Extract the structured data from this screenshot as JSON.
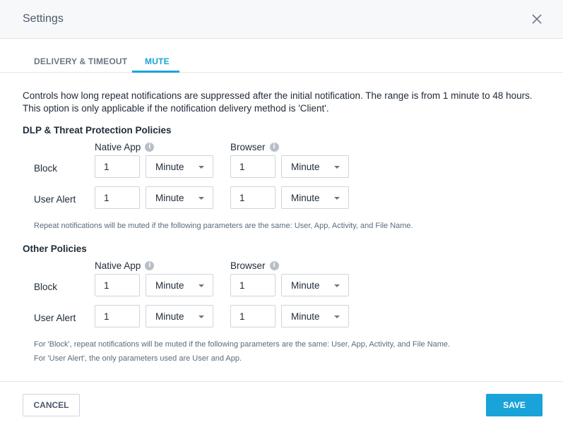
{
  "header": {
    "title": "Settings"
  },
  "tabs": [
    {
      "label": "DELIVERY & TIMEOUT",
      "active": false
    },
    {
      "label": "MUTE",
      "active": true
    }
  ],
  "description": "Controls how long repeat notifications are suppressed after the initial notification. The range is from 1 minute to 48 hours. This option is only applicable if the notification delivery method is 'Client'.",
  "columns": {
    "native_app": "Native App",
    "browser": "Browser",
    "info_glyph": "i"
  },
  "sections": [
    {
      "title": "DLP & Threat Protection Policies",
      "rows": [
        {
          "label": "Block",
          "native_value": "1",
          "native_unit": "Minute",
          "browser_value": "1",
          "browser_unit": "Minute"
        },
        {
          "label": "User Alert",
          "native_value": "1",
          "native_unit": "Minute",
          "browser_value": "1",
          "browser_unit": "Minute"
        }
      ],
      "notes": [
        "Repeat notifications will be muted if the following parameters are the same: User, App, Activity, and File Name."
      ]
    },
    {
      "title": "Other Policies",
      "rows": [
        {
          "label": "Block",
          "native_value": "1",
          "native_unit": "Minute",
          "browser_value": "1",
          "browser_unit": "Minute"
        },
        {
          "label": "User Alert",
          "native_value": "1",
          "native_unit": "Minute",
          "browser_value": "1",
          "browser_unit": "Minute"
        }
      ],
      "notes": [
        "For 'Block', repeat notifications will be muted if the following parameters are the same: User, App, Activity, and File Name.",
        "For 'User Alert', the only parameters used are User and App."
      ]
    }
  ],
  "footer": {
    "cancel_label": "CANCEL",
    "save_label": "SAVE"
  },
  "colors": {
    "accent": "#1aa3d9",
    "text": "#1f2a37",
    "muted": "#5c6b7a",
    "border": "#cfd4da"
  },
  "icons": {
    "close": "close-icon",
    "info": "info-icon",
    "dropdown": "chevron-down-icon"
  }
}
